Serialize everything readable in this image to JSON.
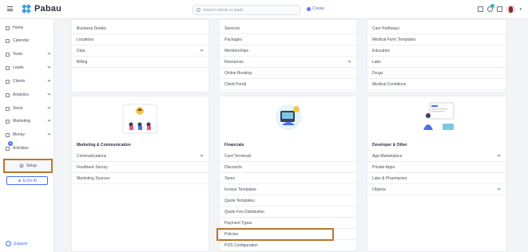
{
  "app": {
    "name": "Pabau"
  },
  "topbar": {
    "search_placeholder": "Search clients or leads",
    "create_label": "Create",
    "plus_glyph": "+",
    "caret_glyph": "▾",
    "icons": [
      "calendar-icon",
      "chat-icon",
      "document-icon"
    ],
    "accent_color": "#4a6cf7"
  },
  "sidebar": {
    "items": [
      {
        "label": "Home",
        "icon": "home-icon",
        "has_chevron": false
      },
      {
        "label": "Calendar",
        "icon": "calendar-icon",
        "has_chevron": false
      },
      {
        "label": "Team",
        "icon": "team-icon",
        "has_chevron": true
      },
      {
        "label": "Leads",
        "icon": "leads-icon",
        "has_chevron": true
      },
      {
        "label": "Clients",
        "icon": "clients-icon",
        "has_chevron": true
      },
      {
        "label": "Analytics",
        "icon": "analytics-icon",
        "has_chevron": true
      },
      {
        "label": "Stock",
        "icon": "stock-icon",
        "has_chevron": true
      },
      {
        "label": "Marketing",
        "icon": "marketing-icon",
        "has_chevron": true
      },
      {
        "label": "Money",
        "icon": "money-icon",
        "has_chevron": true
      },
      {
        "label": "Activities",
        "icon": "activities-icon",
        "has_chevron": false,
        "badge": "8"
      }
    ],
    "setup_label": "Setup",
    "echo_label": "Echo AI",
    "support_label": "Support",
    "support_glyph": "?"
  },
  "columns": {
    "top_left": {
      "rows": [
        {
          "label": "Business Details",
          "chevron": false
        },
        {
          "label": "Locations",
          "chevron": false
        },
        {
          "label": "Data",
          "chevron": true
        },
        {
          "label": "Billing",
          "chevron": false
        }
      ]
    },
    "top_middle": {
      "rows": [
        {
          "label": "Services",
          "chevron": false
        },
        {
          "label": "Packages",
          "chevron": false
        },
        {
          "label": "Memberships",
          "chevron": false
        },
        {
          "label": "Resources",
          "chevron": true
        },
        {
          "label": "Online Booking",
          "chevron": false
        },
        {
          "label": "Client Portal",
          "chevron": false
        }
      ]
    },
    "top_right": {
      "rows": [
        {
          "label": "Care Pathways",
          "chevron": false
        },
        {
          "label": "Medical Form Templates",
          "chevron": false
        },
        {
          "label": "Education",
          "chevron": false
        },
        {
          "label": "Labs",
          "chevron": false
        },
        {
          "label": "Drugs",
          "chevron": false
        },
        {
          "label": "Medical Conditions",
          "chevron": false
        }
      ]
    },
    "marketing": {
      "title": "Marketing & Communication",
      "rows": [
        {
          "label": "Communications",
          "chevron": true
        },
        {
          "label": "Feedback Survey",
          "chevron": false
        },
        {
          "label": "Marketing Sources",
          "chevron": false
        }
      ]
    },
    "financials": {
      "title": "Financials",
      "rows": [
        {
          "label": "Card Terminals",
          "chevron": false
        },
        {
          "label": "Discounts",
          "chevron": false
        },
        {
          "label": "Taxes",
          "chevron": false
        },
        {
          "label": "Invoice Templates",
          "chevron": false
        },
        {
          "label": "Quote Templates",
          "chevron": false
        },
        {
          "label": "Quote Fee Distribution",
          "chevron": false
        },
        {
          "label": "Payment Types",
          "chevron": false
        },
        {
          "label": "Policies",
          "chevron": false
        },
        {
          "label": "POS Configuration",
          "chevron": false
        }
      ]
    },
    "developer": {
      "title": "Developer & Other",
      "rows": [
        {
          "label": "App Marketplace",
          "chevron": true
        },
        {
          "label": "Private Apps",
          "chevron": false
        },
        {
          "label": "Labs & Pharmacies",
          "chevron": false
        },
        {
          "label": "Objects",
          "chevron": true
        }
      ]
    }
  },
  "highlight_color": "#b7782b"
}
